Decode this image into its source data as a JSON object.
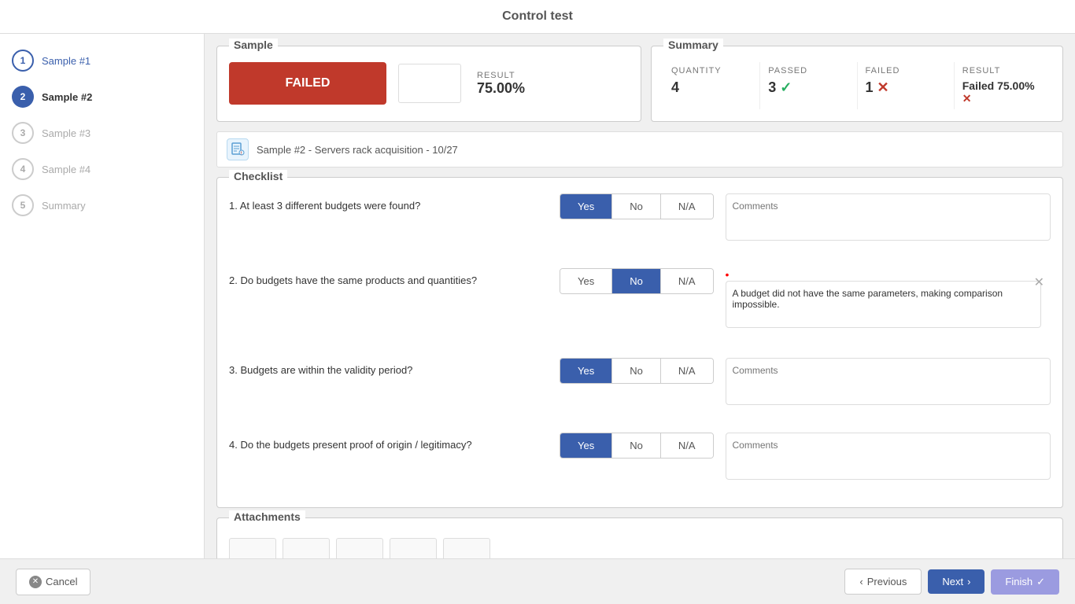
{
  "header": {
    "title": "Control test"
  },
  "sidebar": {
    "items": [
      {
        "id": 1,
        "label": "Sample #1",
        "state": "visited"
      },
      {
        "id": 2,
        "label": "Sample #2",
        "state": "active"
      },
      {
        "id": 3,
        "label": "Sample #3",
        "state": "inactive"
      },
      {
        "id": 4,
        "label": "Sample #4",
        "state": "inactive"
      },
      {
        "id": 5,
        "label": "Summary",
        "state": "inactive"
      }
    ]
  },
  "sample": {
    "legend": "Sample",
    "status": "FAILED",
    "result_label": "RESULT",
    "result_value": "75.00%"
  },
  "summary": {
    "legend": "Summary",
    "quantity_label": "QUANTITY",
    "quantity_value": "4",
    "passed_label": "PASSED",
    "passed_value": "3",
    "failed_label": "FAILED",
    "failed_value": "1",
    "result_label": "RESULT",
    "result_value": "Failed 75.00%"
  },
  "sample_bar": {
    "text": "Sample #2 - Servers rack acquisition - 10/27"
  },
  "checklist": {
    "legend": "Checklist",
    "items": [
      {
        "id": 1,
        "question": "1. At least 3 different budgets were found?",
        "selected": "yes",
        "comment": "",
        "comment_placeholder": "Comments",
        "required": false
      },
      {
        "id": 2,
        "question": "2. Do budgets have the same products and quantities?",
        "selected": "no",
        "comment": "A budget did not have the same parameters, making comparison impossible.",
        "comment_placeholder": "Comments",
        "required": true
      },
      {
        "id": 3,
        "question": "3. Budgets are within the validity period?",
        "selected": "yes",
        "comment": "",
        "comment_placeholder": "Comments",
        "required": false
      },
      {
        "id": 4,
        "question": "4. Do the budgets present proof of origin / legitimacy?",
        "selected": "yes",
        "comment": "",
        "comment_placeholder": "Comments",
        "required": false
      }
    ]
  },
  "attachments": {
    "legend": "Attachments"
  },
  "footer": {
    "cancel_label": "Cancel",
    "previous_label": "Previous",
    "next_label": "Next",
    "finish_label": "Finish"
  }
}
